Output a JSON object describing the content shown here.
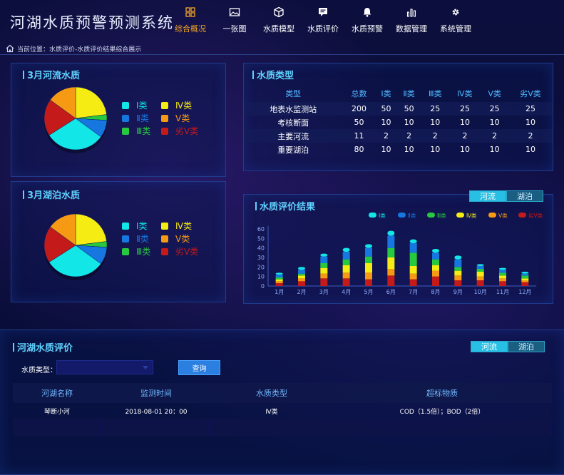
{
  "header": {
    "title": "河湖水质预警预测系统",
    "nav": [
      {
        "label": "综合概况",
        "icon": "grid-icon",
        "active": true
      },
      {
        "label": "一张图",
        "icon": "image-icon",
        "active": false
      },
      {
        "label": "水质模型",
        "icon": "cube-icon",
        "active": false
      },
      {
        "label": "水质评价",
        "icon": "comment-icon",
        "active": false
      },
      {
        "label": "水质预警",
        "icon": "bell-icon",
        "active": false
      },
      {
        "label": "数据管理",
        "icon": "bar-chart-icon",
        "active": false
      },
      {
        "label": "系统管理",
        "icon": "gear-icon",
        "active": false
      }
    ]
  },
  "breadcrumb": {
    "text": "当前位置：水质评价-水质评价结果综合展示"
  },
  "colors": {
    "class1": "#13e6e6",
    "class2": "#1677e0",
    "class3": "#27c93f",
    "class4": "#f5ec13",
    "class5": "#f59a12",
    "inferior5": "#c41a1a"
  },
  "river_panel": {
    "title": "3月河流水质",
    "legend": [
      "Ⅰ类",
      "Ⅱ类",
      "Ⅲ类",
      "Ⅳ类",
      "Ⅴ类",
      "劣Ⅴ类"
    ]
  },
  "lake_panel": {
    "title": "3月湖泊水质",
    "legend": [
      "Ⅰ类",
      "Ⅱ类",
      "Ⅲ类",
      "Ⅳ类",
      "Ⅴ类",
      "劣Ⅴ类"
    ]
  },
  "type_panel": {
    "title": "水质类型",
    "headers": [
      "类型",
      "总数",
      "Ⅰ类",
      "Ⅱ类",
      "Ⅲ类",
      "Ⅳ类",
      "Ⅴ类",
      "劣Ⅴ类"
    ],
    "rows": [
      [
        "地表水监测站",
        "200",
        "50",
        "50",
        "25",
        "25",
        "25",
        "25"
      ],
      [
        "考核断面",
        "50",
        "10",
        "10",
        "10",
        "10",
        "10",
        "10"
      ],
      [
        "主要河流",
        "11",
        "2",
        "2",
        "2",
        "2",
        "2",
        "2"
      ],
      [
        "重要湖泊",
        "80",
        "10",
        "10",
        "10",
        "10",
        "10",
        "10"
      ]
    ]
  },
  "eval_panel": {
    "title": "水质评价结果",
    "toggle": [
      "河流",
      "湖泊"
    ]
  },
  "chart_data": {
    "type": "bar",
    "stacked": true,
    "categories": [
      "1月",
      "2月",
      "3月",
      "4月",
      "5月",
      "6月",
      "7月",
      "8月",
      "9月",
      "10月",
      "11月",
      "12月"
    ],
    "ylim": [
      0,
      60
    ],
    "yticks": [
      "0",
      "10",
      "20",
      "30",
      "40",
      "50",
      "60"
    ],
    "legend_position": "top-right",
    "series": [
      {
        "name": "Ⅰ类",
        "color": "#13e6e6",
        "values": [
          2,
          3,
          3,
          4,
          4,
          5,
          4,
          4,
          4,
          2,
          2,
          2
        ]
      },
      {
        "name": "Ⅱ类",
        "color": "#1677e0",
        "values": [
          3,
          4,
          7,
          8,
          9,
          13,
          10,
          7,
          8,
          3,
          3,
          2
        ]
      },
      {
        "name": "Ⅲ类",
        "color": "#27c93f",
        "values": [
          2,
          2,
          5,
          6,
          7,
          10,
          14,
          6,
          4,
          3,
          3,
          3
        ]
      },
      {
        "name": "Ⅳ类",
        "color": "#f5ec13",
        "values": [
          2,
          3,
          6,
          8,
          10,
          12,
          8,
          6,
          5,
          5,
          3,
          2
        ]
      },
      {
        "name": "Ⅴ类",
        "color": "#f59a12",
        "values": [
          2,
          3,
          5,
          6,
          7,
          7,
          6,
          6,
          5,
          4,
          3,
          2
        ]
      },
      {
        "name": "劣Ⅴ类",
        "color": "#c41a1a",
        "values": [
          3,
          5,
          8,
          8,
          7,
          11,
          7,
          10,
          6,
          6,
          5,
          4
        ]
      }
    ],
    "pies": [
      {
        "panel": "河流",
        "values": [
          {
            "name": "Ⅰ类",
            "value": 31
          },
          {
            "name": "Ⅱ类",
            "value": 9
          },
          {
            "name": "Ⅲ类",
            "value": 3
          },
          {
            "name": "Ⅳ类",
            "value": 23
          },
          {
            "name": "Ⅴ类",
            "value": 15
          },
          {
            "name": "劣Ⅴ类",
            "value": 19
          }
        ]
      },
      {
        "panel": "湖泊",
        "values": [
          {
            "name": "Ⅰ类",
            "value": 31
          },
          {
            "name": "Ⅱ类",
            "value": 9
          },
          {
            "name": "Ⅲ类",
            "value": 3
          },
          {
            "name": "Ⅳ类",
            "value": 23
          },
          {
            "name": "Ⅴ类",
            "value": 15
          },
          {
            "name": "劣Ⅴ类",
            "value": 19
          }
        ]
      }
    ]
  },
  "eval_table": {
    "title": "河湖水质评价",
    "toggle": [
      "河流",
      "湖泊"
    ],
    "filter_label": "水质类型：",
    "filter_value": "",
    "query_label": "查询",
    "headers": [
      "河湖名称",
      "监测时间",
      "水质类型",
      "超标物质"
    ],
    "rows": [
      [
        "琴断小河",
        "2018-08-01  20：00",
        "Ⅳ类",
        "COD（1.5倍）；BOD（2倍）"
      ]
    ]
  }
}
